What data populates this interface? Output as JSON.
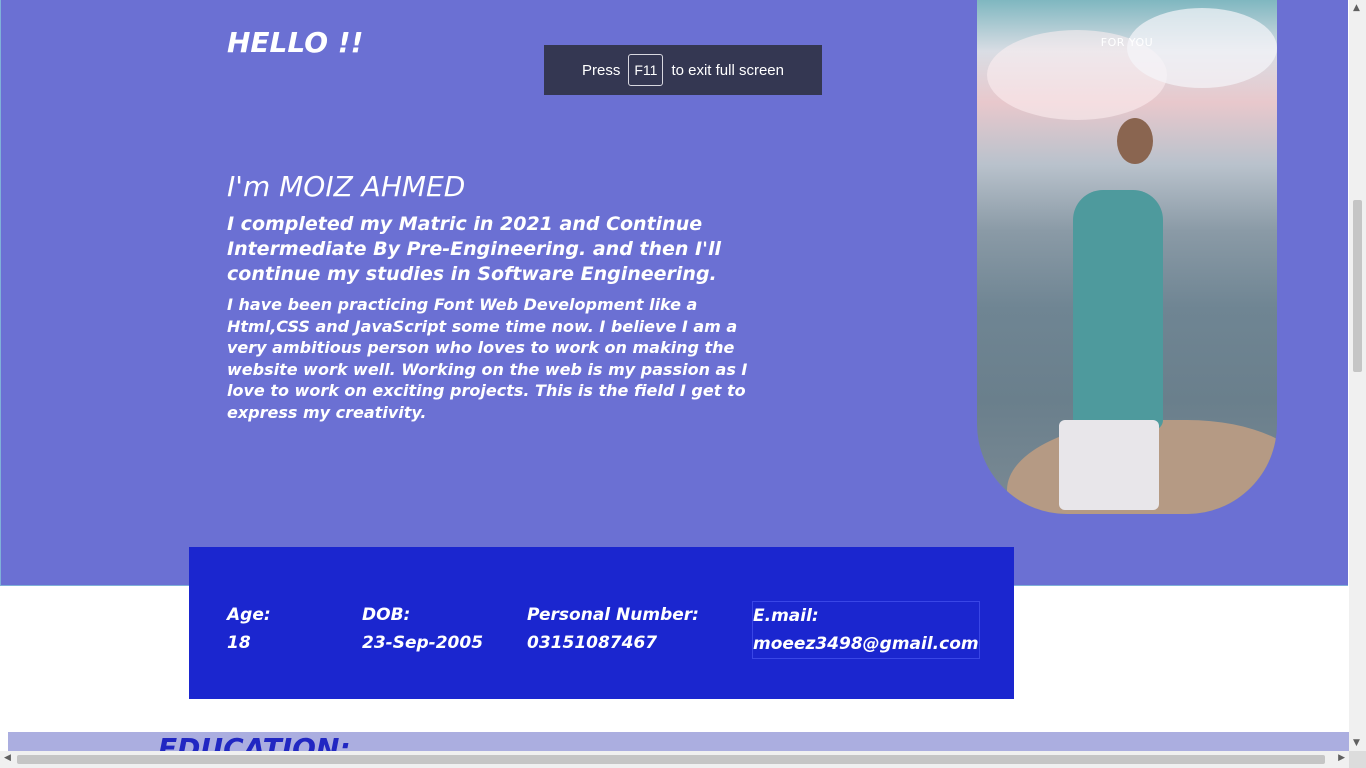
{
  "hero": {
    "greeting": "HELLO !!",
    "name_line": "I'm MOIZ AHMED",
    "education_line": "I completed my Matric in 2021 and Continue Intermediate By Pre-Engineering. and then I'll continue my studies in Software Engineering.",
    "about_line": "I have been practicing Font Web Development like a Html,CSS and JavaScript some time now. I believe I am a very ambitious person who loves to work on making the website work well. Working on the web is my passion as I love to work on exciting projects. This is the field I get to express my creativity.",
    "photo_caption": "FOR YOU",
    "background_color": "#6b70d3"
  },
  "fullscreen_toast": {
    "prefix": "Press",
    "key": "F11",
    "suffix": "to exit full screen"
  },
  "info": {
    "background_color": "#1b26cf",
    "items": [
      {
        "label": "Age:",
        "value": "18"
      },
      {
        "label": "DOB:",
        "value": "23-Sep-2005"
      },
      {
        "label": "Personal Number:",
        "value": "03151087467"
      },
      {
        "label": "E.mail:",
        "value": "moeez3498@gmail.com"
      }
    ]
  },
  "education": {
    "title": "EDUCATION:"
  },
  "scrollbars": {
    "up": "▲",
    "down": "▼",
    "left": "◀",
    "right": "▶"
  }
}
